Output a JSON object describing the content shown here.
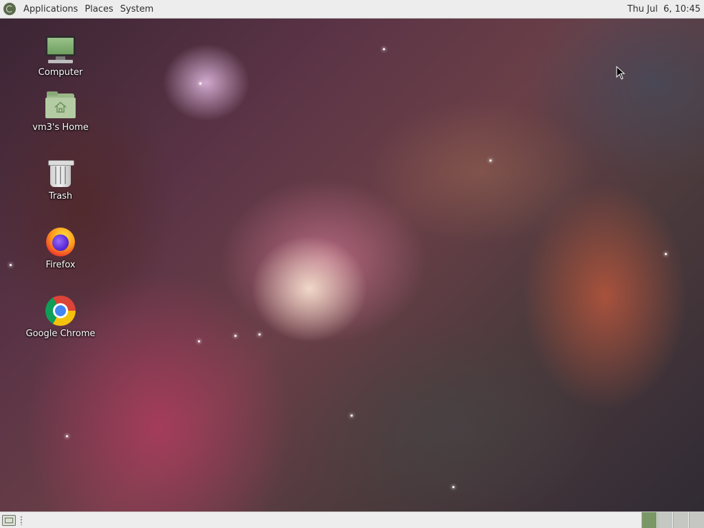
{
  "top_panel": {
    "menus": [
      "Applications",
      "Places",
      "System"
    ],
    "clock": "Thu Jul  6, 10:45"
  },
  "desktop": {
    "icons": [
      {
        "label": "Computer",
        "icon": "computer-icon"
      },
      {
        "label": "vm3's Home",
        "icon": "home-folder-icon"
      },
      {
        "label": "Trash",
        "icon": "trash-icon"
      },
      {
        "label": "Firefox",
        "icon": "firefox-icon"
      },
      {
        "label": "Google Chrome",
        "icon": "chrome-icon"
      }
    ]
  },
  "bottom_panel": {
    "workspaces": 4,
    "active_workspace": 1
  }
}
